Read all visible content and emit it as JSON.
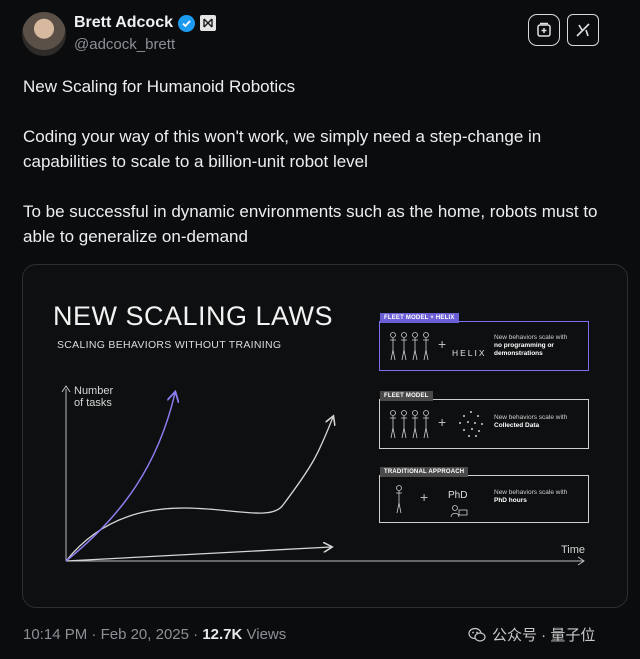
{
  "author": {
    "display_name": "Brett Adcock",
    "handle": "@adcock_brett"
  },
  "icons": [
    "verified-badge-icon",
    "affiliate-badge-icon",
    "grok-icon",
    "x-logo-icon",
    "wechat-icon"
  ],
  "tweet": {
    "paragraphs": [
      "New Scaling for Humanoid Robotics",
      "Coding your way of this won't work, we simply need a step-change in capabilities to scale to a billion-unit robot level",
      "To be successful in dynamic environments such as the home, robots must to able to generalize on-demand"
    ]
  },
  "media": {
    "headline": "NEW SCALING LAWS",
    "subhead": "SCALING BEHAVIORS WITHOUT TRAINING",
    "y_axis_label_1": "Number",
    "y_axis_label_2": "of tasks",
    "x_axis_label": "Time",
    "panels": [
      {
        "tag": "FLEET MODEL + HELIX",
        "middle": "HELIX",
        "desc_prefix": "New behaviors scale with",
        "desc_bold": "no programming or demonstrations",
        "tag_color": "#6b5fd6"
      },
      {
        "tag": "FLEET MODEL",
        "middle": "",
        "desc_prefix": "New behaviors scale with",
        "desc_bold": "Collected Data",
        "tag_color": "#4a4a4a"
      },
      {
        "tag": "TRADITIONAL APPROACH",
        "middle": "PhD",
        "desc_prefix": "New behaviors scale with",
        "desc_bold": "PhD hours",
        "tag_color": "#4a4a4a"
      }
    ],
    "accent_color": "#8a7ff0"
  },
  "footer": {
    "time": "10:14 PM",
    "sep1": "·",
    "date": "Feb 20, 2025",
    "sep2": "·",
    "views_count": "12.7K",
    "views_label": "Views"
  },
  "watermark": {
    "text": "公众号 · 量子位"
  }
}
